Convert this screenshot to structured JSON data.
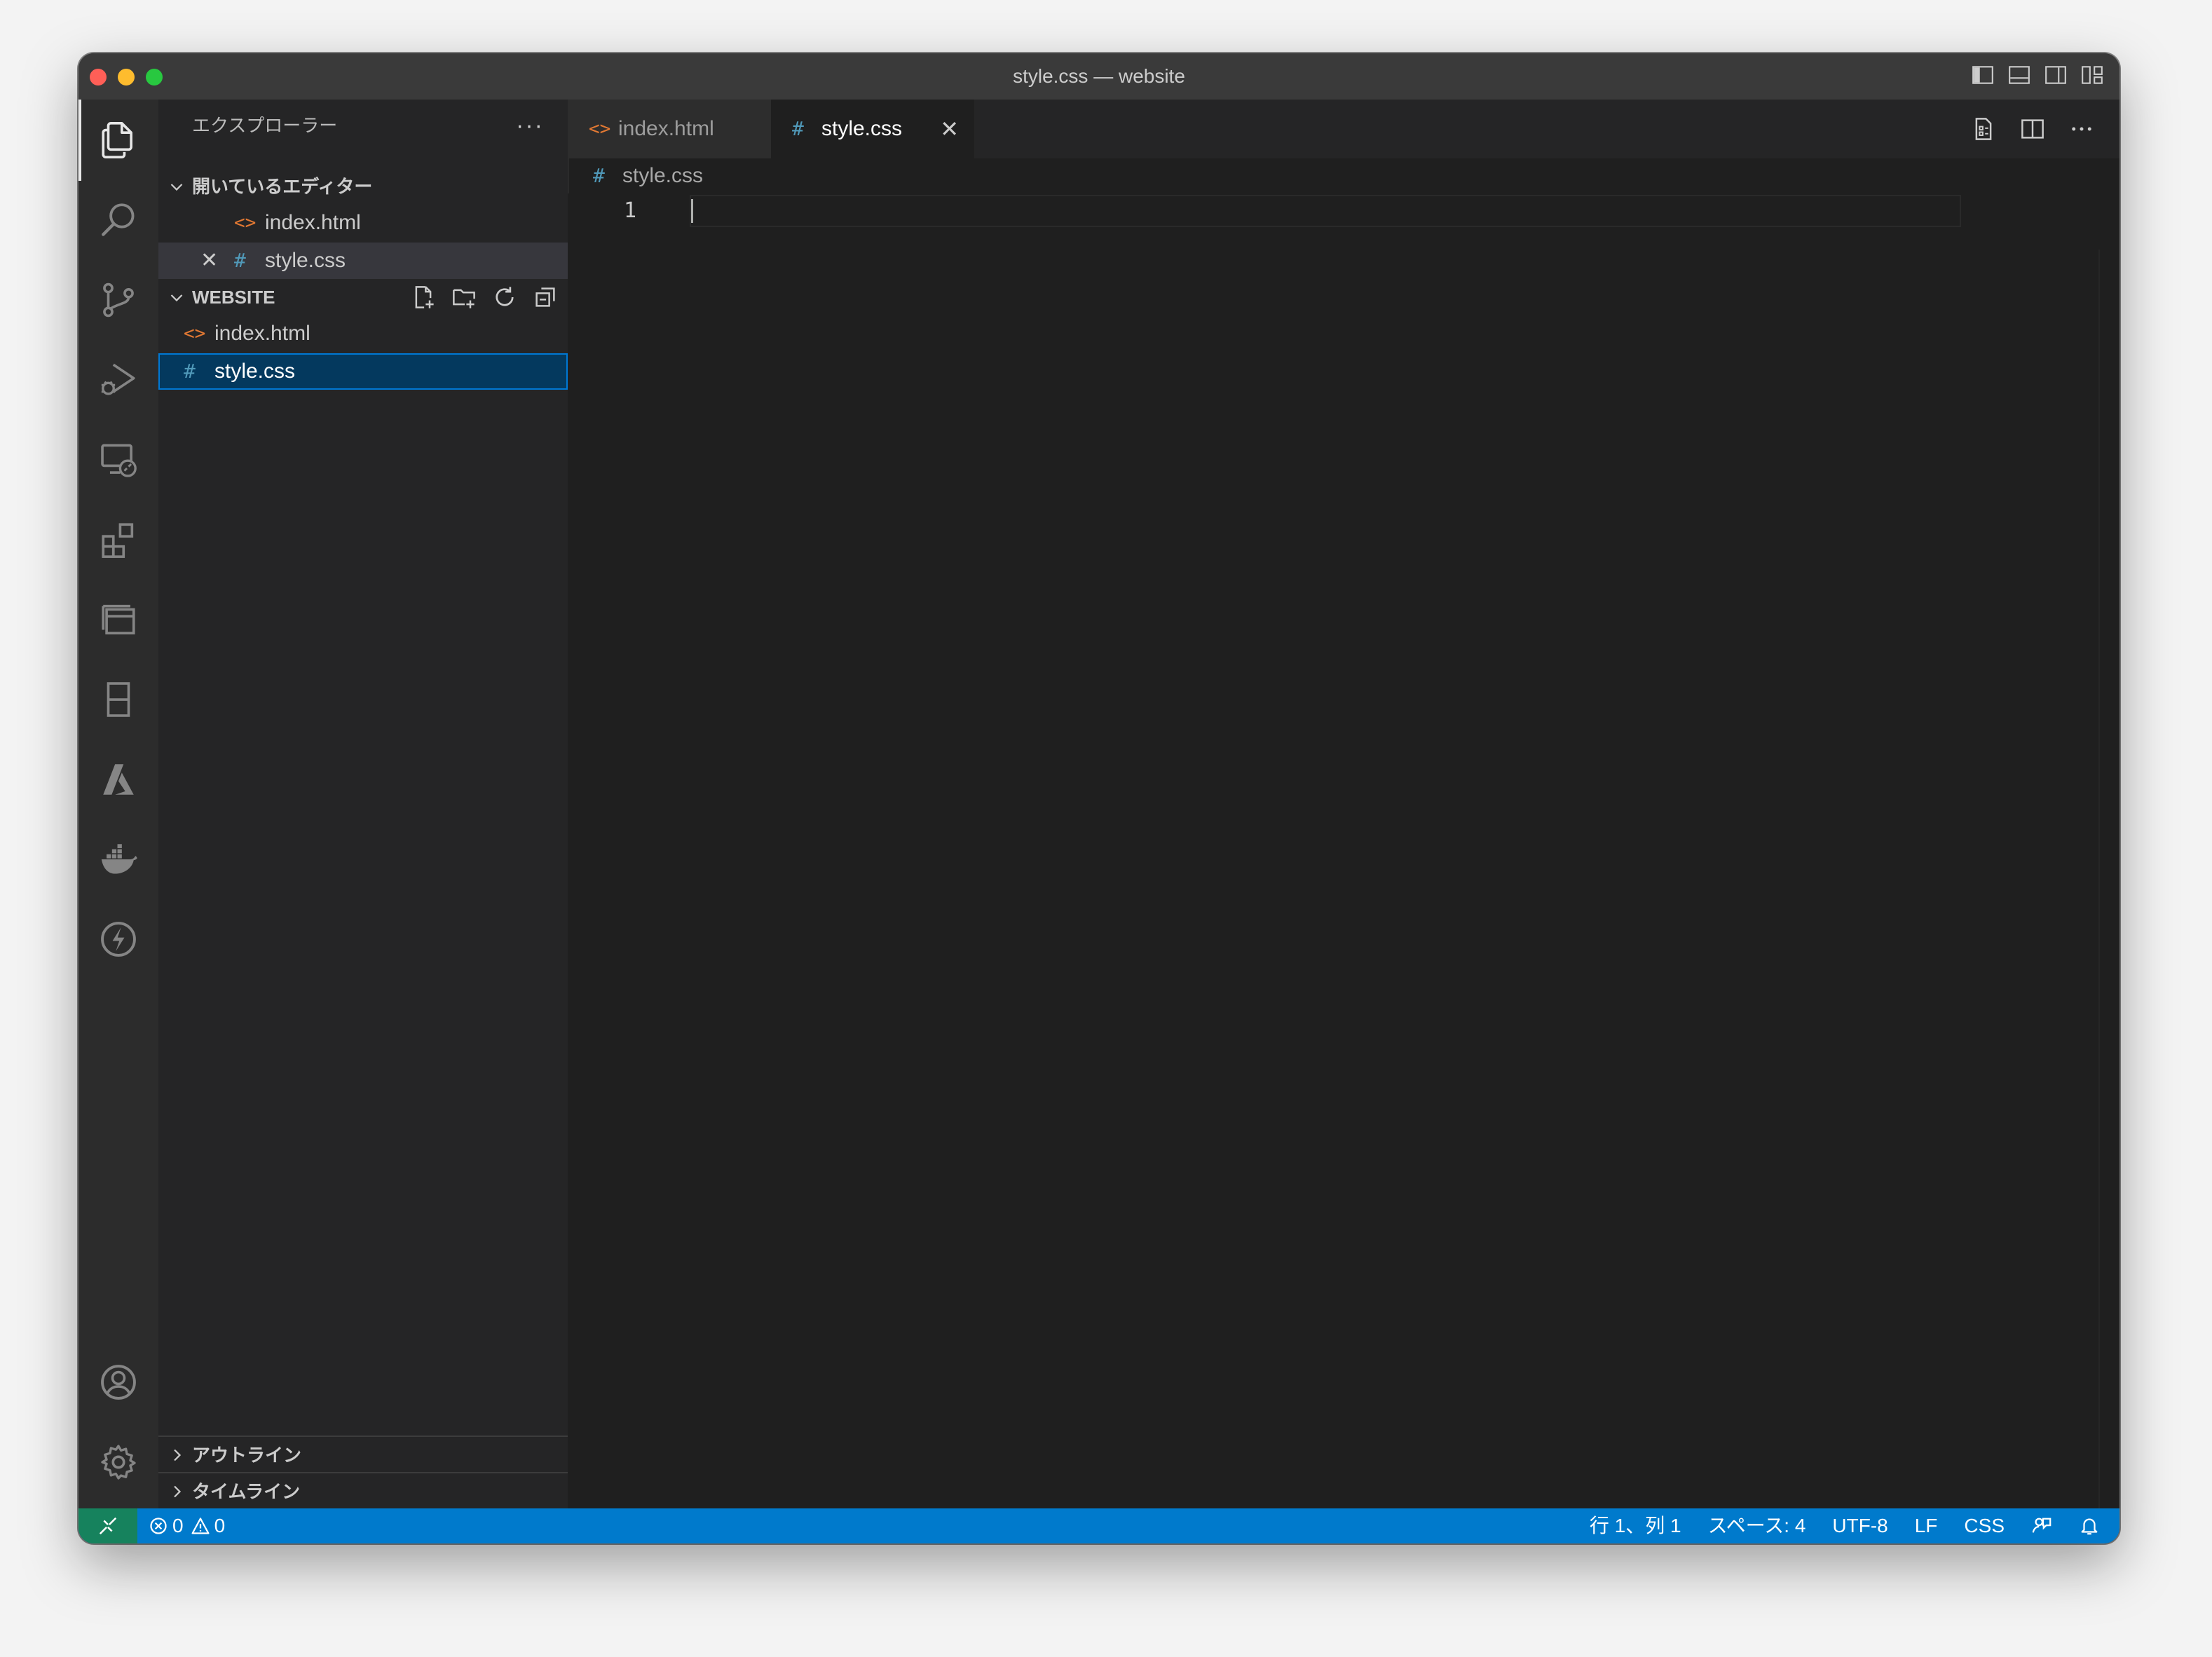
{
  "window": {
    "title": "style.css — website"
  },
  "activity_bar": {
    "items": [
      "explorer-icon",
      "search-icon",
      "source-control-icon",
      "run-debug-icon",
      "remote-explorer-icon",
      "extensions-icon",
      "containers-icon",
      "book-icon",
      "azure-icon",
      "docker-icon",
      "lightning-icon"
    ],
    "bottom_items": [
      "account-icon",
      "settings-gear-icon"
    ]
  },
  "sidebar": {
    "title": "エクスプローラー",
    "more_label": "···",
    "open_editors": {
      "title": "開いているエディター",
      "items": [
        {
          "icon": "<>",
          "label": "index.html"
        },
        {
          "icon": "#",
          "label": "style.css",
          "close": "✕"
        }
      ]
    },
    "website": {
      "title": "WEBSITE",
      "items": [
        {
          "icon": "<>",
          "label": "index.html"
        },
        {
          "icon": "#",
          "label": "style.css"
        }
      ]
    },
    "outline_title": "アウトライン",
    "timeline_title": "タイムライン"
  },
  "tabs": [
    {
      "icon": "<>",
      "label": "index.html"
    },
    {
      "icon": "#",
      "label": "style.css",
      "close": "✕"
    }
  ],
  "breadcrumb": {
    "icon": "#",
    "label": "style.css"
  },
  "editor": {
    "line_numbers": [
      "1"
    ]
  },
  "statusbar": {
    "errors": "0",
    "warnings": "0",
    "position": "行 1、列 1",
    "spaces": "スペース: 4",
    "encoding": "UTF-8",
    "eol": "LF",
    "language": "CSS"
  },
  "colors": {
    "accent": "#007acc",
    "remote": "#16825d",
    "html_icon": "#e37933",
    "css_icon": "#519aba",
    "selection": "#04395e"
  }
}
